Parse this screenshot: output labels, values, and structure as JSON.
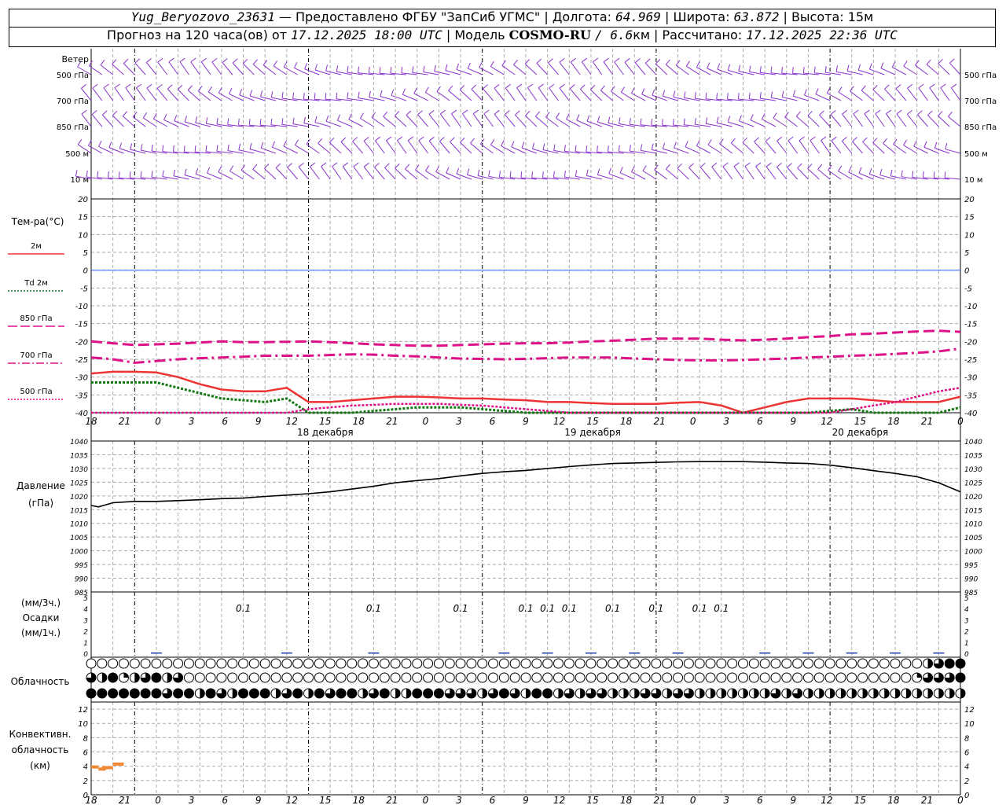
{
  "header": {
    "line1": {
      "station": "Yug_Beryozovo_23631",
      "provider": "— Предоставлено ФГБУ \"ЗапСиб УГМС\" |",
      "lon_label": "Долгота:",
      "lon": "64.969",
      "lat_label": "| Широта:",
      "lat": "63.872",
      "alt_label": "| Высота:",
      "alt": "15м"
    },
    "line2": {
      "prefix": "Прогноз на 120 часа(ов) от",
      "issued": "17.12.2025 18:00 UTC",
      "model_label": "| Модель",
      "model": "COSMO-RU",
      "res": "/ 6.6",
      "res_unit": "км",
      "calc_label": "| Рассчитано:",
      "calc": "17.12.2025 22:36 UTC"
    }
  },
  "chart_data": [
    {
      "type": "wind-barbs",
      "section_label": "Ветер",
      "levels": [
        "500 гПа",
        "700 гПа",
        "850 гПа",
        "500 м",
        "10 м"
      ]
    },
    {
      "type": "line",
      "section_label": "Тем-ра(°С)",
      "yticks": [
        20,
        15,
        10,
        5,
        0,
        -5,
        -10,
        -15,
        -20,
        -25,
        -30,
        -35,
        -40
      ],
      "ylim": [
        -40,
        20
      ],
      "hours": [
        0,
        3,
        6,
        9,
        12,
        15,
        18,
        21,
        24,
        27,
        30,
        33,
        36,
        39,
        42,
        45,
        48,
        51,
        54,
        57,
        60,
        63,
        66,
        69,
        72,
        75,
        78,
        81,
        84,
        87,
        90,
        93,
        96,
        99,
        102,
        105,
        108,
        111,
        114,
        117,
        120
      ],
      "series": [
        {
          "name": "2м",
          "color": "#ee3333",
          "style": "solid",
          "width": 2.5,
          "values": [
            -29,
            -28.5,
            -28.5,
            -28.7,
            -30,
            -32,
            -33.5,
            -34,
            -34,
            -33,
            -37,
            -37,
            -36.5,
            -36,
            -35.5,
            -35.5,
            -35.7,
            -36,
            -36,
            -36.3,
            -36.5,
            -37,
            -37,
            -37.3,
            -37.5,
            -37.5,
            -37.5,
            -37.2,
            -37,
            -38,
            -40,
            -38.5,
            -37,
            -36,
            -36,
            -36,
            -36.5,
            -37,
            -37,
            -37,
            -35.5
          ]
        },
        {
          "name": "Td 2м",
          "color": "#117711",
          "style": "dotted",
          "width": 3,
          "values": [
            -31.5,
            -31.5,
            -31.5,
            -31.5,
            -33,
            -34.5,
            -36,
            -36.5,
            -37,
            -36,
            -40,
            -40,
            -40,
            -39.5,
            -39,
            -38.5,
            -38.5,
            -38.5,
            -39,
            -39.5,
            -40,
            -40,
            -40,
            -40,
            -40,
            -40,
            -40,
            -40,
            -40,
            -40,
            -40,
            -40,
            -40,
            -40,
            -39.5,
            -39,
            -40,
            -40,
            -40,
            -40,
            -38.5
          ]
        },
        {
          "name": "850 гПа",
          "color": "#dd1188",
          "style": "dash",
          "width": 3,
          "values": [
            -20,
            -20.5,
            -21,
            -20.8,
            -20.6,
            -20.3,
            -20,
            -20.2,
            -20.2,
            -20.1,
            -20,
            -20.2,
            -20.5,
            -20.8,
            -21,
            -21.2,
            -21.2,
            -21,
            -20.8,
            -20.6,
            -20.5,
            -20.5,
            -20.3,
            -20,
            -19.8,
            -19.5,
            -19.2,
            -19.2,
            -19.2,
            -19.5,
            -19.7,
            -19.5,
            -19.2,
            -18.8,
            -18.5,
            -18,
            -17.8,
            -17.5,
            -17.2,
            -17,
            -17.3
          ]
        },
        {
          "name": "700 гПа",
          "color": "#dd1188",
          "style": "dashdot",
          "width": 3,
          "values": [
            -24.5,
            -25,
            -26,
            -25.5,
            -25,
            -24.7,
            -24.5,
            -24.3,
            -24,
            -24,
            -24,
            -23.8,
            -23.6,
            -23.7,
            -24,
            -24.2,
            -24.5,
            -24.8,
            -24.9,
            -25,
            -24.9,
            -24.7,
            -24.5,
            -24.5,
            -24.5,
            -24.8,
            -25,
            -25.2,
            -25.3,
            -25.3,
            -25.2,
            -25,
            -24.8,
            -24.5,
            -24.3,
            -24,
            -23.8,
            -23.5,
            -23.2,
            -22.8,
            -22
          ]
        },
        {
          "name": "500 гПа",
          "color": "#dd1188",
          "style": "dotted-fine",
          "width": 2.5,
          "values": [
            -41,
            -41,
            -41,
            -41,
            -41,
            -41,
            -41,
            -41,
            -40.5,
            -40,
            -39,
            -38.5,
            -38,
            -37.8,
            -37.5,
            -37.5,
            -37.5,
            -37.8,
            -38,
            -38.5,
            -39,
            -39.5,
            -40,
            -40.5,
            -41,
            -41,
            -41,
            -41,
            -41,
            -41,
            -41,
            -41,
            -41,
            -40.5,
            -40,
            -39,
            -38,
            -37,
            -35.5,
            -34,
            -33
          ]
        },
        {
          "name": "zero-line",
          "color": "#3366ff",
          "style": "thin",
          "width": 1,
          "values": [
            0,
            0
          ]
        }
      ]
    },
    {
      "type": "line",
      "section_label": "Давление",
      "unit": "(гПа)",
      "yticks": [
        1040,
        1035,
        1030,
        1025,
        1020,
        1015,
        1010,
        1005,
        1000,
        995,
        990,
        985
      ],
      "ylim": [
        985,
        1040
      ],
      "hours": [
        0,
        1,
        3,
        6,
        9,
        12,
        15,
        18,
        21,
        24,
        27,
        30,
        33,
        36,
        39,
        42,
        45,
        48,
        51,
        54,
        57,
        60,
        63,
        66,
        69,
        72,
        75,
        78,
        81,
        84,
        87,
        90,
        93,
        96,
        99,
        102,
        105,
        108,
        111,
        114,
        117,
        120
      ],
      "values": [
        1016.5,
        1016,
        1017.5,
        1018,
        1018,
        1018.3,
        1018.6,
        1019,
        1019.2,
        1019.8,
        1020.3,
        1020.8,
        1021.5,
        1022.5,
        1023.5,
        1024.8,
        1025.6,
        1026.3,
        1027.3,
        1028.2,
        1028.8,
        1029.3,
        1030,
        1030.7,
        1031.3,
        1031.8,
        1032,
        1032.2,
        1032.4,
        1032.5,
        1032.5,
        1032.5,
        1032.3,
        1032,
        1031.8,
        1031.2,
        1030.3,
        1029.2,
        1028.2,
        1027,
        1024.8,
        1021.5
      ],
      "color": "#000000"
    },
    {
      "type": "bar",
      "section_label": "Осадки",
      "unit_top": "(мм/3ч.)",
      "unit_bottom": "(мм/1ч.)",
      "yticks": [
        5,
        4,
        3,
        2,
        1,
        0
      ],
      "labels": [
        {
          "hour": 21,
          "text": "0.1"
        },
        {
          "hour": 39,
          "text": "0.1"
        },
        {
          "hour": 51,
          "text": "0.1"
        },
        {
          "hour": 60,
          "text": "0.1"
        },
        {
          "hour": 63,
          "text": "0.1"
        },
        {
          "hour": 66,
          "text": "0.1"
        },
        {
          "hour": 72,
          "text": "0.1"
        },
        {
          "hour": 78,
          "text": "0.1"
        },
        {
          "hour": 84,
          "text": "0.1"
        },
        {
          "hour": 87,
          "text": "0.1"
        }
      ],
      "amounts_hours": [
        9,
        27,
        39,
        57,
        63,
        69,
        75,
        81,
        93,
        99,
        105,
        111,
        117
      ]
    },
    {
      "type": "table",
      "section_label": "Облачность",
      "rows": [
        "000000000000000000000000000000000000000000000000000000000000000000000000000002344",
        "324123423000000000000000000000000000000000000000000000000000000000000000000013334",
        "444444434424324442342434423422444333234324423233222332332222222323222222222222222"
      ]
    },
    {
      "type": "bar",
      "section_label": "Конвективн. облачность (км)",
      "yticks": [
        12,
        10,
        8,
        6,
        4,
        2,
        0
      ],
      "ylim": [
        0,
        13
      ],
      "segments": [
        {
          "h0": 0,
          "h1": 1,
          "value": 3.9
        },
        {
          "h0": 1,
          "h1": 2,
          "value": 3.6
        },
        {
          "h0": 1.5,
          "h1": 3,
          "value": 3.8
        },
        {
          "h0": 3,
          "h1": 4.5,
          "value": 4.3
        }
      ],
      "color": "#ee8833"
    }
  ],
  "time_axis": {
    "ticks": [
      "18",
      "21",
      "0",
      "3",
      "6",
      "9",
      "12",
      "15",
      "18",
      "21",
      "0",
      "3",
      "6",
      "9",
      "12",
      "15",
      "18",
      "21",
      "0",
      "3",
      "6",
      "9",
      "12",
      "15",
      "18",
      "21",
      "0"
    ],
    "days": [
      {
        "hour": 42,
        "label": "18 декабря"
      },
      {
        "hour": 90,
        "label": "19 декабря"
      },
      {
        "hour": 138,
        "label": "20 декабря"
      }
    ]
  }
}
